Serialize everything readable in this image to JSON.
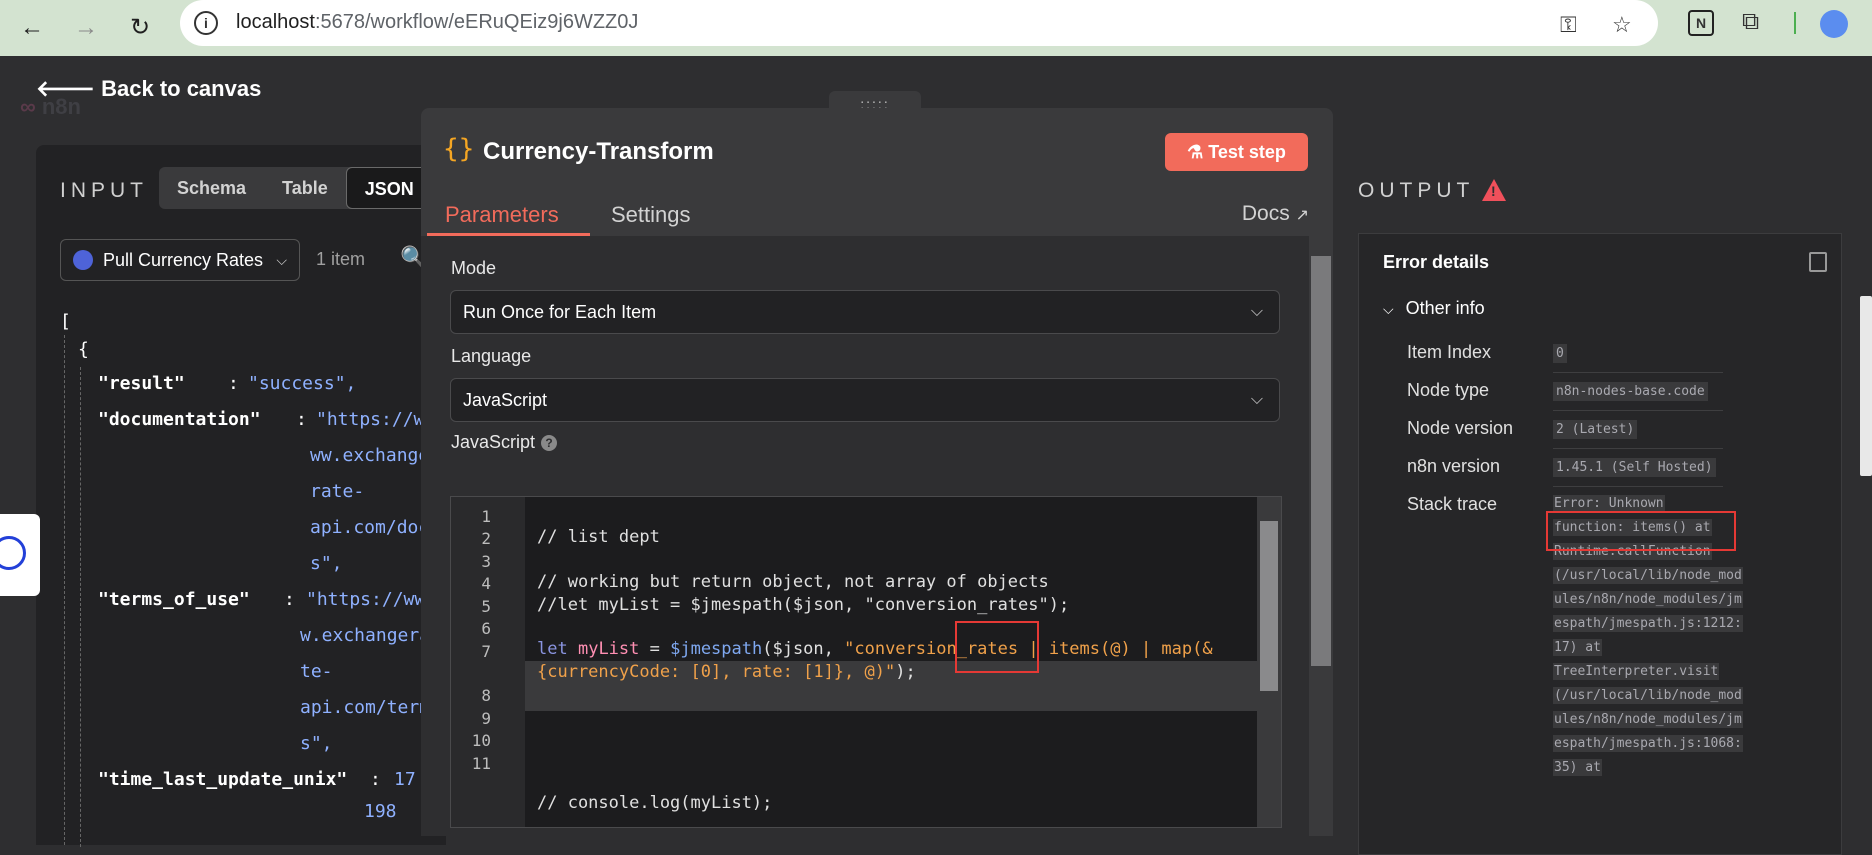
{
  "browser": {
    "url_host": "localhost",
    "url_path": ":5678/workflow/eERuQEiz9j6WZZ0J"
  },
  "app": {
    "back_label": "Back to canvas",
    "logo": "n8n"
  },
  "input_panel": {
    "title": "INPUT",
    "view_tabs": [
      "Schema",
      "Table",
      "JSON"
    ],
    "active_view": "JSON",
    "node_select": "Pull Currency Rates",
    "items_count": "1 item",
    "json_lines": {
      "l1": "[",
      "l2": "{",
      "result_key": "\"result\"",
      "result_val": "\"success\",",
      "doc_key": "\"documentation\"",
      "doc_val": [
        "\"https://w",
        "ww.exchange",
        "rate-",
        "api.com/doc",
        "s\","
      ],
      "terms_key": "\"terms_of_use\"",
      "terms_val": [
        "\"https://ww",
        "w.exchangera",
        "te-",
        "api.com/term",
        "s\","
      ],
      "time_key": "\"time_last_update_unix\"",
      "time_val": [
        "17",
        "198"
      ]
    }
  },
  "modal": {
    "handle": ":::::",
    "icon": "{}",
    "title": "Currency-Transform",
    "test_button": "Test step",
    "tabs": {
      "parameters": "Parameters",
      "settings": "Settings"
    },
    "docs": "Docs",
    "mode_label": "Mode",
    "mode_value": "Run Once for Each Item",
    "language_label": "Language",
    "language_value": "JavaScript",
    "code_label": "JavaScript",
    "line_numbers": [
      "1",
      "2",
      "3",
      "4",
      "5",
      "6",
      "7",
      "8",
      "9",
      "10",
      "11"
    ],
    "code": {
      "l2": "// list dept",
      "l4": "// working but return object, not array of objects",
      "l5": "//let myList = $jmespath($json, \"conversion_rates\");",
      "l7_kw": "let",
      "l7_var": "myList",
      "l7_eq": " = ",
      "l7_fn": "$jmespath",
      "l7_args": "($json, ",
      "l7_str1": "\"conversion_rates | ",
      "l7_items": "items(@)",
      "l7_str2": " | map(&",
      "l7b_str": "{currencyCode: [0], rate: [1]}, @)\"",
      "l7b_end": ");",
      "l11": "// console.log(myList);"
    }
  },
  "output_panel": {
    "title": "OUTPUT",
    "error_title": "Error details",
    "other_info": "Other info",
    "rows": [
      {
        "label": "Item Index",
        "value": "0"
      },
      {
        "label": "Node type",
        "value": "n8n-nodes-base.code"
      },
      {
        "label": "Node version",
        "value": "2 (Latest)"
      },
      {
        "label": "n8n version",
        "value": "1.45.1 (Self Hosted)"
      }
    ],
    "stack_label": "Stack trace",
    "stack_lines": [
      "Error: Unknown",
      "function: items() at",
      "Runtime.callFunction",
      "(/usr/local/lib/node_mod",
      "ules/n8n/node_modules/jm",
      "espath/jmespath.js:1212:",
      "17) at",
      "TreeInterpreter.visit",
      "(/usr/local/lib/node_mod",
      "ules/n8n/node_modules/jm",
      "espath/jmespath.js:1068:",
      "35) at"
    ]
  }
}
